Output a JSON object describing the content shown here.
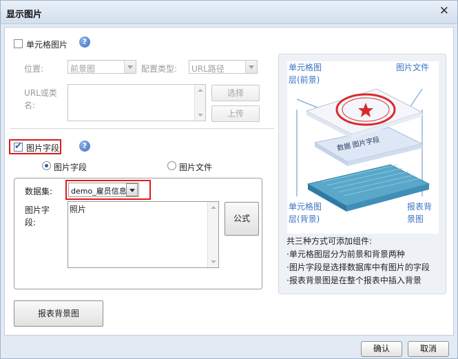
{
  "window": {
    "title": "显示图片",
    "close_glyph": "✕"
  },
  "cell_image": {
    "checkbox_label": "单元格图片",
    "checked": false,
    "position_label": "位置:",
    "position_value": "前景图",
    "config_type_label": "配置类型:",
    "config_type_value": "URL路径",
    "url_label_line1": "URL或类",
    "url_label_line2": "名:",
    "select_button": "选择",
    "upload_button": "上传"
  },
  "image_field": {
    "checkbox_label": "图片字段",
    "checked": true,
    "radio_field_label": "图片字段",
    "radio_file_label": "图片文件",
    "selected_radio": "图片字段",
    "dataset_label": "数据集:",
    "dataset_value": "demo_雇员信息",
    "field_label_line1": "图片字",
    "field_label_line2": "段:",
    "field_value": "照片",
    "formula_button": "公式"
  },
  "report_bg_button": "报表背景图",
  "preview": {
    "label_top_left_line1": "单元格图",
    "label_top_left_line2": "层(前景)",
    "label_top_right": "图片文件",
    "label_bottom_left_line1": "单元格图",
    "label_bottom_left_line2": "层(背景)",
    "label_bottom_right_line1": "报表背",
    "label_bottom_right_line2": "景图",
    "layer_text": "数据  图片字段"
  },
  "description": {
    "intro": "共三种方式可添加组件:",
    "items": [
      "·单元格图层分为前景和背景两种",
      "·图片字段是选择数据库中有图片的字段",
      "·报表背景图是在整个报表中插入背景"
    ]
  },
  "footer": {
    "ok": "确认",
    "cancel": "取消"
  },
  "colors": {
    "accent": "#3a73c4",
    "highlight": "#e0191c",
    "title_bg": "#d3dfee"
  }
}
